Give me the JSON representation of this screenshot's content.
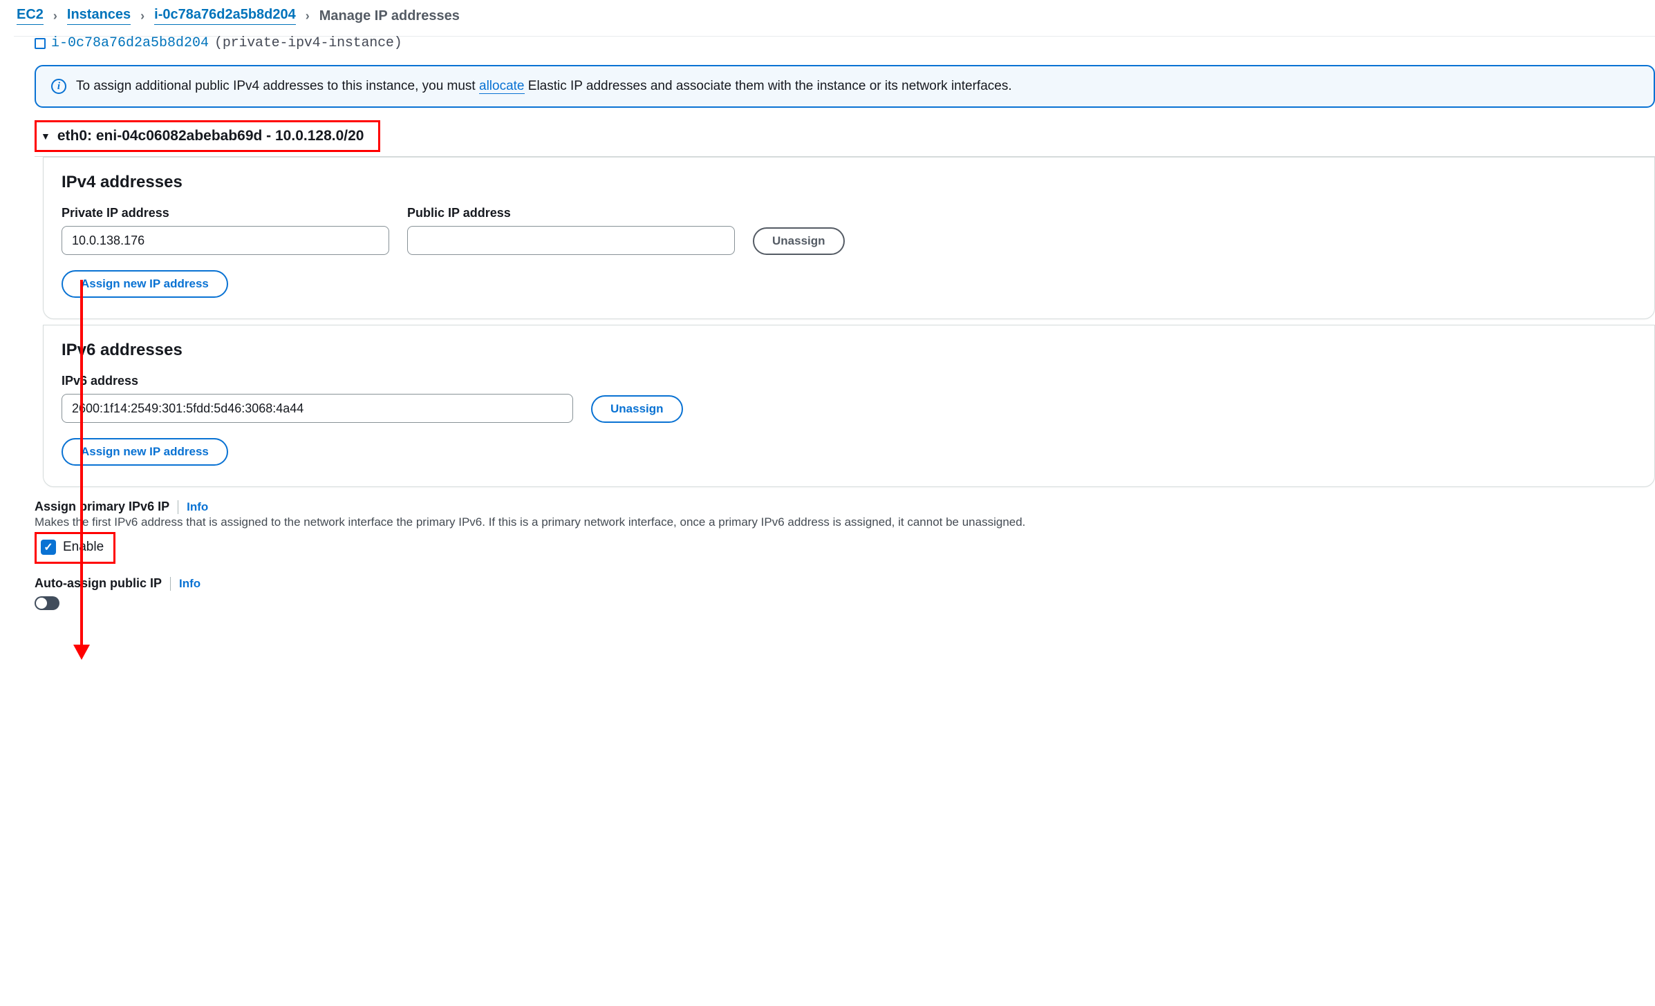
{
  "breadcrumb": {
    "items": [
      "EC2",
      "Instances",
      "i-0c78a76d2a5b8d204"
    ],
    "current": "Manage IP addresses"
  },
  "truncated_row": {
    "id": "i-0c78a76d2a5b8d204",
    "note": "(private-ipv4-instance)"
  },
  "banner": {
    "prefix": "To assign additional public IPv4 addresses to this instance, you must ",
    "link": "allocate",
    "suffix": " Elastic IP addresses and associate them with the instance or its network interfaces."
  },
  "eni": {
    "header": "eth0: eni-04c06082abebab69d - 10.0.128.0/20"
  },
  "ipv4": {
    "title": "IPv4 addresses",
    "private_label": "Private IP address",
    "private_value": "10.0.138.176",
    "public_label": "Public IP address",
    "public_value": "",
    "unassign": "Unassign",
    "assign_new": "Assign new IP address"
  },
  "ipv6": {
    "title": "IPv6 addresses",
    "addr_label": "IPv6 address",
    "addr_value": "2600:1f14:2549:301:5fdd:5d46:3068:4a44",
    "unassign": "Unassign",
    "assign_new": "Assign new IP address"
  },
  "primary_ipv6": {
    "title": "Assign primary IPv6 IP",
    "info": "Info",
    "desc": "Makes the first IPv6 address that is assigned to the network interface the primary IPv6. If this is a primary network interface, once a primary IPv6 address is assigned, it cannot be unassigned.",
    "enable": "Enable"
  },
  "auto_assign": {
    "title": "Auto-assign public IP",
    "info": "Info"
  }
}
